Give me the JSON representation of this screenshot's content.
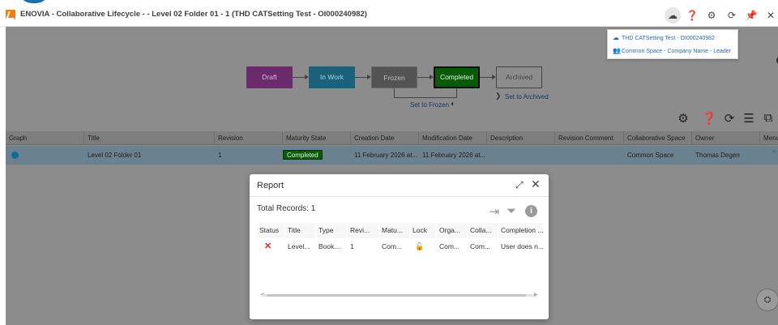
{
  "titlebar": {
    "title": "ENOVIA - Collaborative Lifecycle - - Level 02 Folder 01 - 1 (THD CATSetting Test - OI000240982)",
    "icons": [
      "cloud-icon",
      "help-icon",
      "gear-icon",
      "refresh-icon",
      "pin-icon",
      "close-icon"
    ]
  },
  "infocard": {
    "collab_space_label": "THD CATSetting Test - OI000240982",
    "role_label": "Common Space - Company Name - Leader"
  },
  "lifecycle": {
    "states": [
      "Draft",
      "In Work",
      "Frozen",
      "Completed",
      "Archived"
    ],
    "current_state": "Completed",
    "set_to_frozen": "Set to Frozen",
    "set_to_archived": "Set to Archived",
    "colors": {
      "draft": "#6b2a6b",
      "in_work": "#1c617b",
      "frozen": "#535353",
      "completed": "#0a5a0a"
    }
  },
  "grid": {
    "columns": [
      "Graph",
      "Title",
      "Revision",
      "Maturity State",
      "Creation Date",
      "Modification Date",
      "Description",
      "Revision Comment",
      "Collaborative Space",
      "Owner",
      "Menu"
    ],
    "row": {
      "title": "Level 02 Folder 01",
      "revision": "1",
      "maturity": "Completed",
      "creation_date": "11 February 2026 at...",
      "modification_date": "11 February 2026 at...",
      "description": "",
      "revision_comment": "",
      "collab_space": "Common Space",
      "owner": "Thomas Degen"
    }
  },
  "report": {
    "title": "Report",
    "total_records": "Total Records: 1",
    "columns": [
      "Status",
      "Title",
      "Type",
      "Revi...",
      "Matu...",
      "Lock",
      "Orga...",
      "Colla...",
      "Completion ..."
    ],
    "row": {
      "status_icon": "error-x-icon",
      "title": "Level...",
      "type": "Book...",
      "revision": "1",
      "maturity": "Com...",
      "lock_icon": "unlock-icon",
      "organization": "Com...",
      "collab": "Com...",
      "completion": "User does n..."
    }
  }
}
